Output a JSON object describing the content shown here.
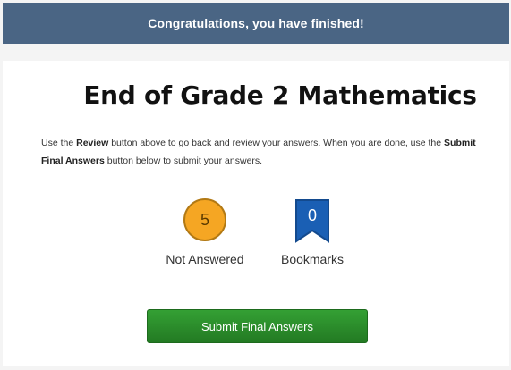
{
  "banner": {
    "text": "Congratulations, you have finished!"
  },
  "test": {
    "title": "End of Grade 2 Mathematics"
  },
  "instructions": {
    "part1": "Use the ",
    "review_word": "Review",
    "part2": " button above to go back and review your answers. When you are done, use the ",
    "submit_word": "Submit Final Answers",
    "part3": " button below to submit your answers."
  },
  "stats": {
    "not_answered": {
      "count": "5",
      "label": "Not Answered",
      "color": "#f5a623"
    },
    "bookmarks": {
      "count": "0",
      "label": "Bookmarks",
      "color": "#1a5fb4"
    }
  },
  "submit": {
    "label": "Submit Final Answers",
    "color": "#2e8b2e"
  }
}
